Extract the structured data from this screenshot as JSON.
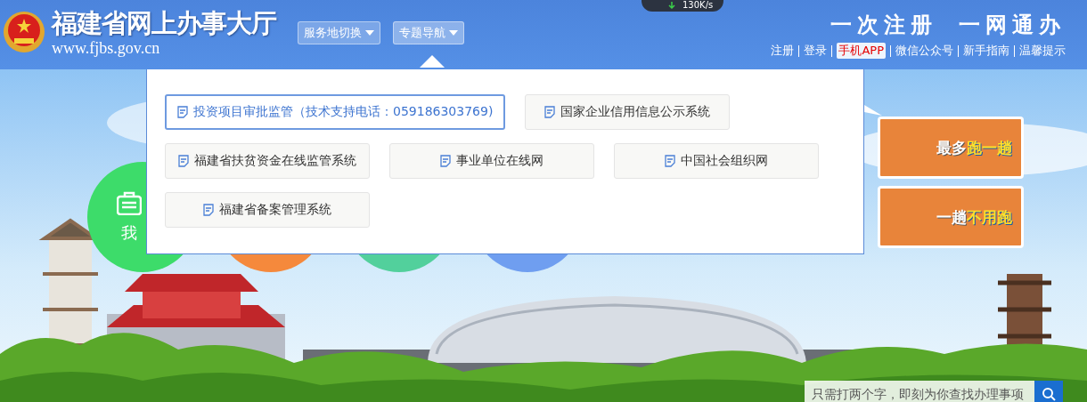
{
  "header": {
    "site_title": "福建省网上办事大厅",
    "site_url": "www.fjbs.gov.cn",
    "dropdowns": [
      {
        "label": "服务地切换",
        "expanded": false
      },
      {
        "label": "专题导航",
        "expanded": true
      }
    ],
    "slogan": [
      "一次注册",
      "一网通办"
    ],
    "links": [
      {
        "label": "注册",
        "highlight": false
      },
      {
        "label": "登录",
        "highlight": false
      },
      {
        "label": "手机APP",
        "highlight": true
      },
      {
        "label": "微信公众号",
        "highlight": false
      },
      {
        "label": "新手指南",
        "highlight": false
      },
      {
        "label": "温馨提示",
        "highlight": false
      }
    ]
  },
  "speed_widget": {
    "reading": "130K/s"
  },
  "topic_menu": {
    "items": [
      {
        "label": "投资项目审批监管（技术支持电话：059186303769)",
        "selected": true
      },
      {
        "label": "国家企业信用信息公示系统",
        "selected": false
      },
      {
        "label": "福建省扶贫资金在线监管系统",
        "selected": false
      },
      {
        "label": "事业单位在线网",
        "selected": false
      },
      {
        "label": "中国社会组织网",
        "selected": false
      },
      {
        "label": "福建省备案管理系统",
        "selected": false
      }
    ]
  },
  "service_circles": [
    {
      "label": "我",
      "color": "#3ddc6a"
    },
    {
      "color": "#f5893c"
    },
    {
      "color": "#52d09c"
    },
    {
      "color": "#6f9ef0"
    }
  ],
  "banners": [
    {
      "text": "最多",
      "highlight": "跑一趟"
    },
    {
      "text": "一趟",
      "highlight": "不用跑"
    }
  ],
  "search": {
    "placeholder": "只需打两个字，即刻为你查找办理事项"
  }
}
